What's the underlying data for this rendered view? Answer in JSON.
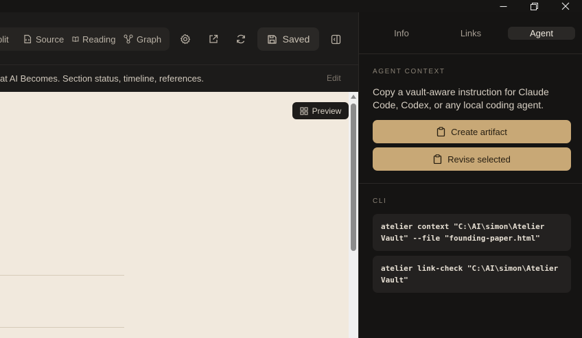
{
  "window": {
    "minimize_icon": "minimize-icon",
    "restore_icon": "restore-icon",
    "close_icon": "close-icon"
  },
  "toolbar": {
    "modes": [
      {
        "label": "plit",
        "icon": "split-icon"
      },
      {
        "label": "Source",
        "icon": "file-code-icon"
      },
      {
        "label": "Reading",
        "icon": "book-open-icon"
      },
      {
        "label": "Graph",
        "icon": "graph-icon"
      }
    ],
    "saved_label": "Saved"
  },
  "subbar": {
    "text": "at AI Becomes. Section status, timeline, references.",
    "edit_label": "Edit"
  },
  "document": {
    "preview_label": "Preview"
  },
  "panel": {
    "tabs": [
      {
        "label": "Info",
        "active": false
      },
      {
        "label": "Links",
        "active": false
      },
      {
        "label": "Agent",
        "active": true
      }
    ],
    "agent_context_label": "AGENT CONTEXT",
    "agent_description": "Copy a vault-aware instruction for Claude Code, Codex, or any local coding agent.",
    "create_artifact_label": "Create artifact",
    "revise_selected_label": "Revise selected",
    "cli_label": "CLI",
    "cli_commands": [
      "atelier context \"C:\\AI\\simon\\Atelier Vault\" --file \"founding-paper.html\"",
      "atelier link-check \"C:\\AI\\simon\\Atelier Vault\""
    ]
  },
  "colors": {
    "accent_gold": "#c8a876",
    "document_bg": "#f1e9dd",
    "panel_bg": "#151413"
  }
}
